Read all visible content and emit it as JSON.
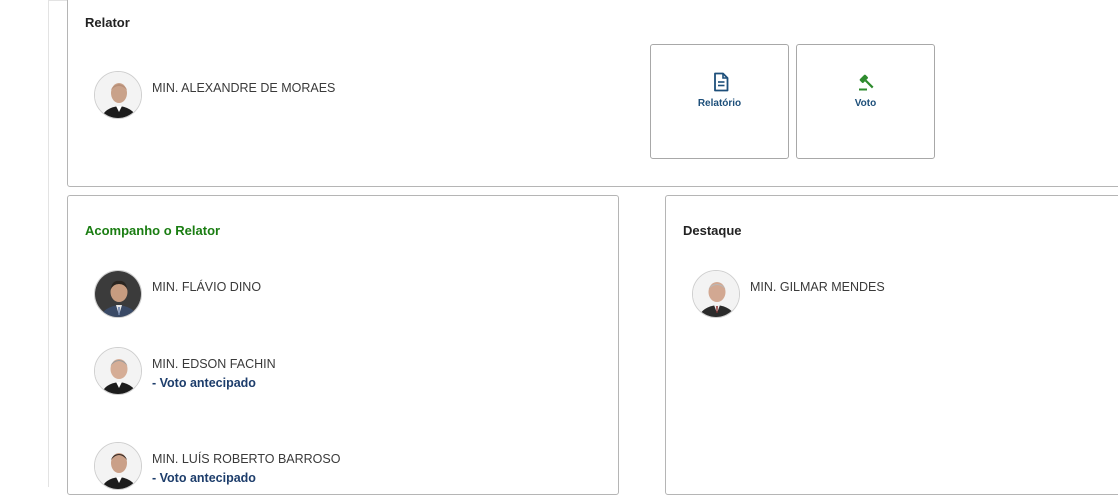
{
  "relator_section": {
    "title": "Relator",
    "minister": {
      "name": "MIN. ALEXANDRE DE MORAES"
    },
    "actions": [
      {
        "label": "Relatório",
        "icon": "document-icon"
      },
      {
        "label": "Voto",
        "icon": "gavel-icon"
      }
    ]
  },
  "follow_section": {
    "title": "Acompanho o Relator",
    "title_color": "#1a7d12",
    "ministers": [
      {
        "name": "MIN. FLÁVIO DINO",
        "note": ""
      },
      {
        "name": "MIN. EDSON FACHIN",
        "note": "- Voto antecipado"
      },
      {
        "name": "MIN. LUÍS ROBERTO BARROSO",
        "note": "- Voto antecipado"
      }
    ]
  },
  "highlight_section": {
    "title": "Destaque",
    "minister": {
      "name": "MIN. GILMAR MENDES"
    }
  },
  "colors": {
    "accent_link": "#1d4f7a",
    "note_text": "#1d3d6b",
    "gavel_icon": "#2e8b2e"
  }
}
